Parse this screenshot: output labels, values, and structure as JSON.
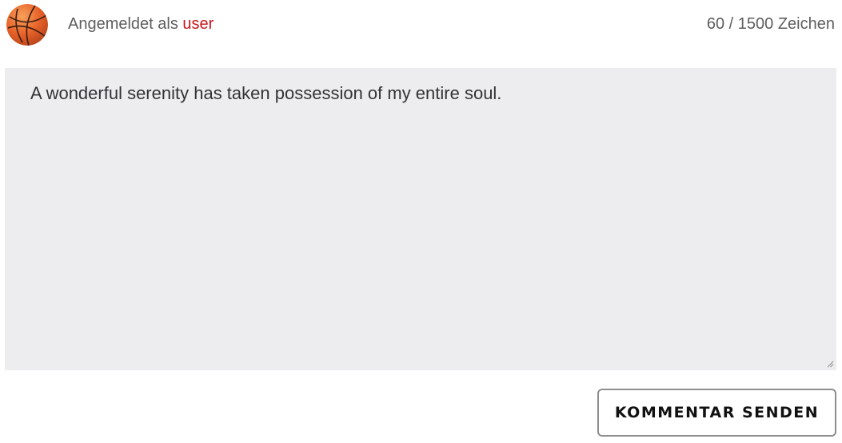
{
  "header": {
    "avatar_icon": "basketball-icon",
    "login_prefix": "Angemeldet als ",
    "username": "user",
    "char_count": "60 / 1500 Zeichen"
  },
  "comment": {
    "value": "A wonderful serenity has taken possession of my entire soul."
  },
  "submit": {
    "label": "KOMMENTAR SENDEN"
  },
  "colors": {
    "username": "#c8171a",
    "textarea_bg": "#ededef",
    "button_border": "#8e8e8e",
    "avatar_orange": "#e8642a"
  }
}
